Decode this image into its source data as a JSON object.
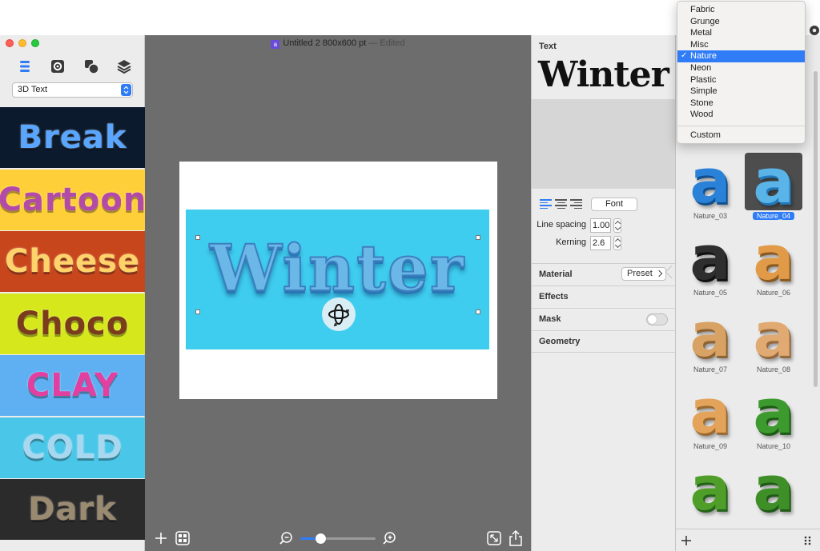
{
  "window": {
    "document_title": "Untitled 2 800x600 pt",
    "edited_suffix": "— Edited",
    "app_badge": "a"
  },
  "sidebar": {
    "category_select_value": "3D Text",
    "styles": [
      {
        "label": "Break",
        "bg": "#0c1a2e",
        "color": "#5aa6ff"
      },
      {
        "label": "Cartoon",
        "bg": "#ffcf3a",
        "color": "#b44aa8"
      },
      {
        "label": "Cheese",
        "bg": "#c8461c",
        "color": "#ffd36a"
      },
      {
        "label": "Choco",
        "bg": "#d6e81c",
        "color": "#7a3c1a"
      },
      {
        "label": "CLAY",
        "bg": "#5fb0f2",
        "color": "#e23fa0"
      },
      {
        "label": "COLD",
        "bg": "#49c6e8",
        "color": "#a8d8f0"
      },
      {
        "label": "Dark",
        "bg": "#2b2b2b",
        "color": "#9a8a70"
      }
    ]
  },
  "canvas": {
    "word": "Winter",
    "bg_color": "#3fcdef"
  },
  "inspector": {
    "text_label": "Text",
    "preview_word": "Winter",
    "font_button": "Font",
    "line_spacing_label": "Line spacing",
    "line_spacing_value": "1.00",
    "kerning_label": "Kerning",
    "kerning_value": "2.6",
    "sections": {
      "material": "Material",
      "effects": "Effects",
      "mask": "Mask",
      "geometry": "Geometry"
    },
    "preset_button": "Preset"
  },
  "material_menu": {
    "items": [
      "Fabric",
      "Grunge",
      "Metal",
      "Misc",
      "Nature",
      "Neon",
      "Plastic",
      "Simple",
      "Stone",
      "Wood"
    ],
    "selected": "Nature",
    "check_glyph": "✓",
    "custom": "Custom"
  },
  "presets": {
    "items": [
      {
        "name": "Nature_03",
        "color": "#2a82d8",
        "shade": "#11508f"
      },
      {
        "name": "Nature_04",
        "color": "#5ab4e8",
        "shade": "#2378b8"
      },
      {
        "name": "Nature_05",
        "color": "#2e2e2e",
        "shade": "#111111"
      },
      {
        "name": "Nature_06",
        "color": "#e09a48",
        "shade": "#8a5a22"
      },
      {
        "name": "Nature_07",
        "color": "#d7a264",
        "shade": "#8b6232"
      },
      {
        "name": "Nature_08",
        "color": "#e0aa72",
        "shade": "#96683a"
      },
      {
        "name": "Nature_09",
        "color": "#e3a35a",
        "shade": "#9a6a30"
      },
      {
        "name": "Nature_10",
        "color": "#3d9a2e",
        "shade": "#1c5a15"
      },
      {
        "name": "",
        "color": "#4f9e2a",
        "shade": "#24631a"
      },
      {
        "name": "",
        "color": "#3f8f28",
        "shade": "#1f5a16"
      }
    ],
    "selected_name": "Nature_04"
  }
}
